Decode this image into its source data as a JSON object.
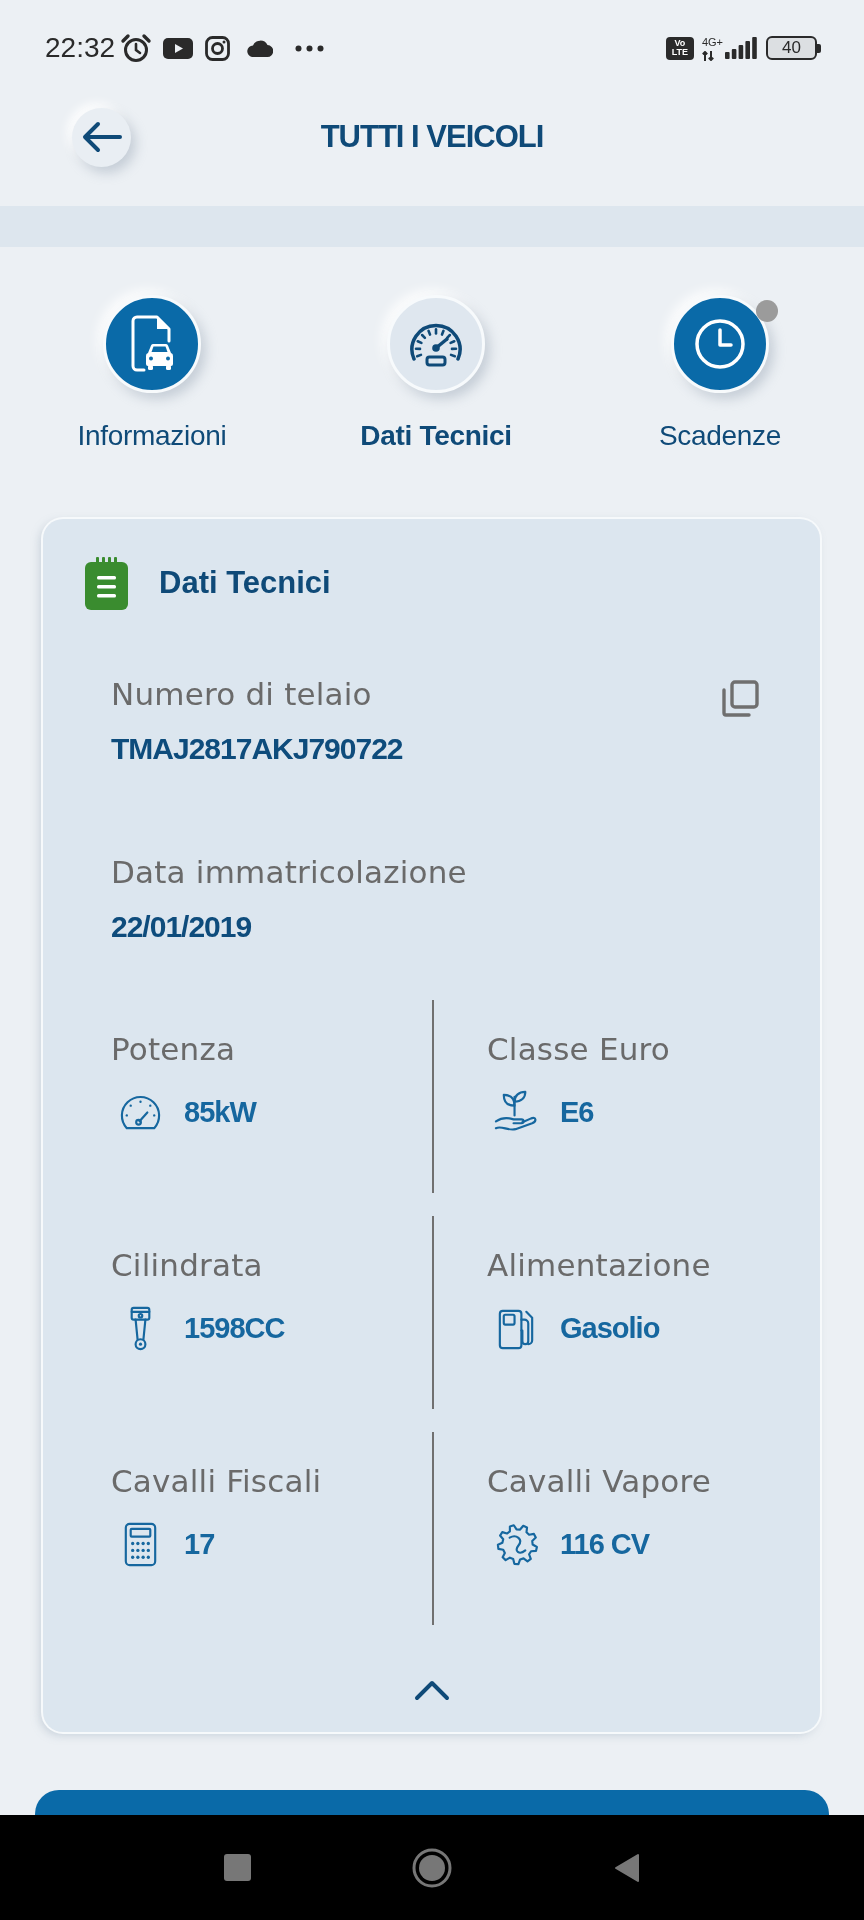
{
  "status_bar": {
    "time": "22:32",
    "volte": "Vo LTE",
    "network_type": "4G+",
    "battery": "40"
  },
  "header": {
    "title": "TUTTI I VEICOLI"
  },
  "tabs": [
    {
      "label": "Informazioni",
      "kind": "document-car",
      "selected": false,
      "notice": false
    },
    {
      "label": "Dati Tecnici",
      "kind": "speedometer",
      "selected": true,
      "notice": false
    },
    {
      "label": "Scadenze",
      "kind": "clock",
      "selected": false,
      "notice": true
    }
  ],
  "card": {
    "title": "Dati Tecnici",
    "expanded": true,
    "fields": [
      {
        "label": "Numero di telaio",
        "value": "TMAJ2817AKJ790722",
        "copyable": true
      },
      {
        "label": "Data immatricolazione",
        "value": "22/01/2019",
        "copyable": false
      }
    ],
    "specs": [
      {
        "label": "Potenza",
        "value": "85kW",
        "kind": "gauge"
      },
      {
        "label": "Classe Euro",
        "value": "E6",
        "kind": "leaf-hand"
      },
      {
        "label": "Cilindrata",
        "value": "1598CC",
        "kind": "piston"
      },
      {
        "label": "Alimentazione",
        "value": "Gasolio",
        "kind": "fuel-pump"
      },
      {
        "label": "Cavalli Fiscali",
        "value": "17",
        "kind": "calculator"
      },
      {
        "label": "Cavalli Vapore",
        "value": "116 CV",
        "kind": "engine-gear"
      }
    ]
  }
}
